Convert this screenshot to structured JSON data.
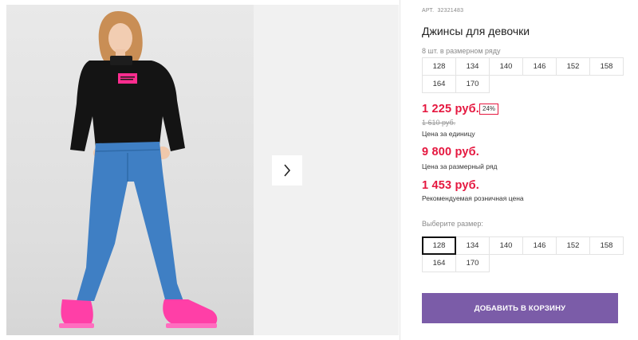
{
  "product": {
    "art_label": "АРТ.",
    "art_number": "32321483",
    "title": "Джинсы для девочки"
  },
  "gallery": {
    "next_icon": "chevron-right-icon"
  },
  "size_row": {
    "label": "8 шт. в размерном ряду",
    "sizes": [
      "128",
      "134",
      "140",
      "146",
      "152",
      "158",
      "164",
      "170"
    ]
  },
  "pricing": {
    "unit_price": "1 225 руб.",
    "discount": "24%",
    "old_price": "1 610 руб.",
    "unit_caption": "Цена за единицу",
    "row_price": "9 800 руб.",
    "row_caption": "Цена за размерный ряд",
    "retail_price": "1 453 руб.",
    "retail_caption": "Рекомендуемая розничная цена"
  },
  "size_select": {
    "label": "Выберите размер:",
    "selected": "128",
    "sizes": [
      "128",
      "134",
      "140",
      "146",
      "152",
      "158",
      "164",
      "170"
    ]
  },
  "cart": {
    "button_label": "ДОБАВИТЬ В КОРЗИНУ"
  },
  "colors": {
    "accent_red": "#e5173f",
    "button_purple": "#7b5ca8",
    "jacket_patch": "#ff2d8f",
    "sneakers": "#ff3fa7"
  }
}
